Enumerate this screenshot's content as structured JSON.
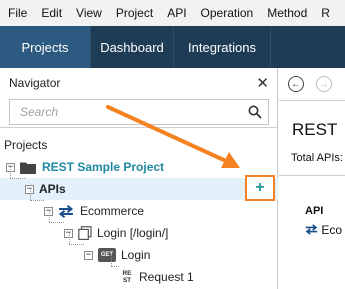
{
  "menu": [
    "File",
    "Edit",
    "View",
    "Project",
    "API",
    "Operation",
    "Method",
    "R"
  ],
  "tabs": [
    "Projects",
    "Dashboard",
    "Integrations"
  ],
  "navigator": {
    "title": "Navigator",
    "close_icon": "close-icon",
    "search_placeholder": "Search"
  },
  "tree": {
    "root_label": "Projects",
    "project": "REST Sample Project",
    "apis": "APIs",
    "api_name": "Ecommerce",
    "resource": "Login [/login/]",
    "method": "Login",
    "method_badge": "GET",
    "request": "Request 1",
    "request_badge_top": "RE",
    "request_badge_bottom": "ST"
  },
  "add_button_label": "+",
  "right": {
    "title": "REST",
    "subtitle": "Total APIs:",
    "api_header": "API",
    "api_item": "Eco"
  },
  "colors": {
    "tabbar": "#1f3c56",
    "active_tab": "#2d5a80",
    "accent_orange": "#f58220",
    "teal": "#1f88a3",
    "selection": "#e3f1fa"
  }
}
